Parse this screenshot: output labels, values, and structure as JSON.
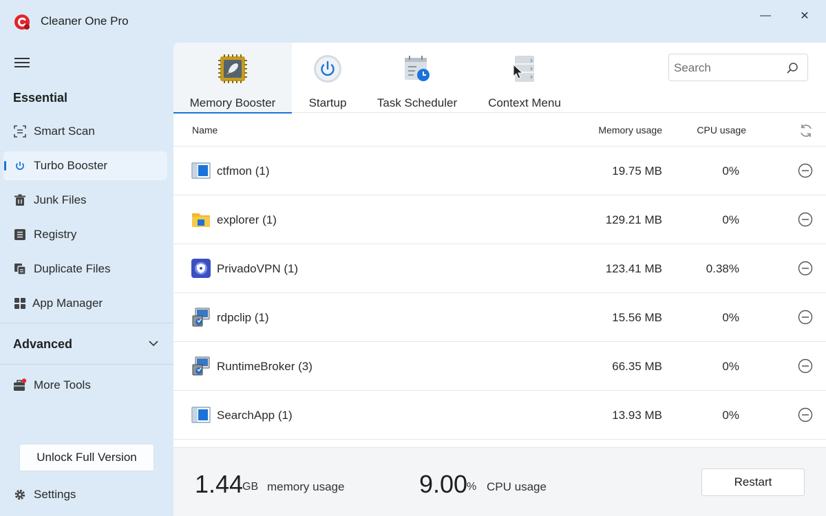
{
  "app": {
    "title": "Cleaner One Pro"
  },
  "window": {
    "minimize_symbol": "—",
    "close_symbol": "✕"
  },
  "sidebar": {
    "essential_title": "Essential",
    "items": [
      {
        "label": "Smart Scan",
        "icon": "scan-icon"
      },
      {
        "label": "Turbo Booster",
        "icon": "power-icon",
        "active": true
      },
      {
        "label": "Junk Files",
        "icon": "trash-icon"
      },
      {
        "label": "Registry",
        "icon": "registry-icon"
      },
      {
        "label": "Duplicate Files",
        "icon": "duplicate-icon"
      },
      {
        "label": "App Manager",
        "icon": "apps-grid-icon"
      }
    ],
    "advanced_title": "Advanced",
    "more_tools_label": "More Tools",
    "unlock_label": "Unlock Full Version",
    "settings_label": "Settings"
  },
  "tabs": [
    {
      "label": "Memory Booster",
      "icon": "memory-chip-icon",
      "active": true
    },
    {
      "label": "Startup",
      "icon": "power-button-icon"
    },
    {
      "label": "Task Scheduler",
      "icon": "task-scheduler-icon"
    },
    {
      "label": "Context Menu",
      "icon": "context-menu-icon"
    }
  ],
  "search": {
    "placeholder": "Search",
    "value": ""
  },
  "table": {
    "columns": {
      "name": "Name",
      "memory": "Memory usage",
      "cpu": "CPU usage"
    },
    "rows": [
      {
        "name": "ctfmon (1)",
        "memory": "19.75 MB",
        "cpu": "0%",
        "icon": "window-app-icon"
      },
      {
        "name": "explorer (1)",
        "memory": "129.21 MB",
        "cpu": "0%",
        "icon": "folder-icon"
      },
      {
        "name": "PrivadoVPN (1)",
        "memory": "123.41 MB",
        "cpu": "0.38%",
        "icon": "vpn-icon"
      },
      {
        "name": "rdpclip (1)",
        "memory": "15.56 MB",
        "cpu": "0%",
        "icon": "installer-icon"
      },
      {
        "name": "RuntimeBroker (3)",
        "memory": "66.35 MB",
        "cpu": "0%",
        "icon": "installer-icon"
      },
      {
        "name": "SearchApp (1)",
        "memory": "13.93 MB",
        "cpu": "0%",
        "icon": "window-app-icon"
      }
    ]
  },
  "footer": {
    "memory_value": "1.44",
    "memory_unit": "GB",
    "memory_label": "memory usage",
    "cpu_value": "9.00",
    "cpu_unit": "%",
    "cpu_label": "CPU usage",
    "restart_label": "Restart"
  },
  "colors": {
    "accent": "#1a73d9",
    "sidebar_bg": "#dbeaf6",
    "brand_red": "#e0252f"
  }
}
